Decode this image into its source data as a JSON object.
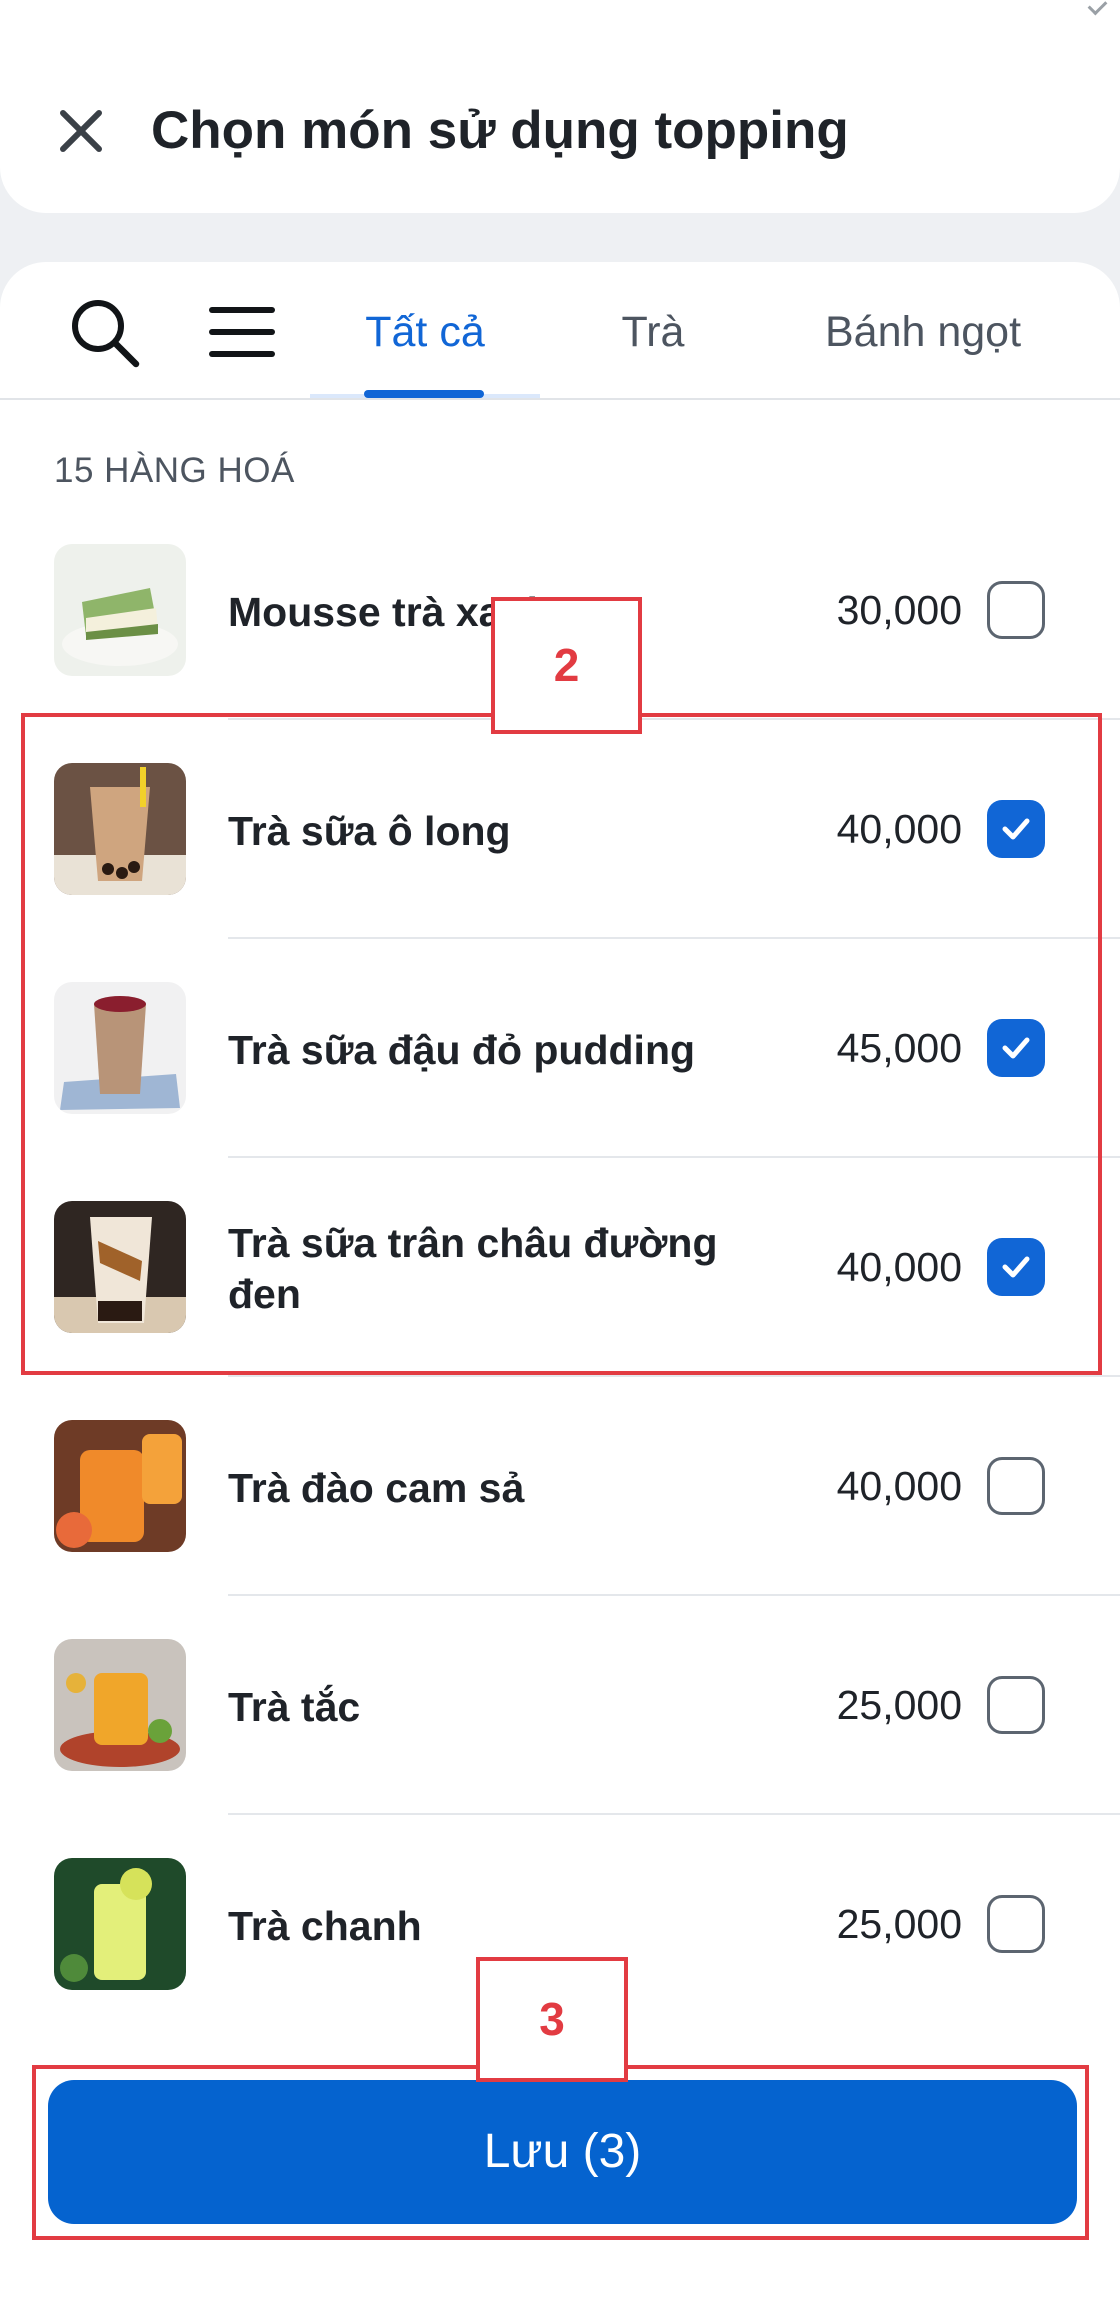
{
  "header": {
    "title": "Chọn món sử dụng topping",
    "close_icon": "close-icon"
  },
  "tabs": {
    "search_icon": "search-icon",
    "menu_icon": "menu-icon",
    "items": [
      {
        "label": "Tất cả",
        "active": true
      },
      {
        "label": "Trà",
        "active": false
      },
      {
        "label": "Bánh ngọt",
        "active": false
      }
    ]
  },
  "list": {
    "count_label": "15 HÀNG HOÁ",
    "items": [
      {
        "name": "Mousse trà xanh",
        "price": "30,000",
        "checked": false
      },
      {
        "name": "Trà sữa ô long",
        "price": "40,000",
        "checked": true
      },
      {
        "name": "Trà sữa đậu đỏ pudding",
        "price": "45,000",
        "checked": true
      },
      {
        "name": "Trà sữa trân châu đường đen",
        "price": "40,000",
        "checked": true
      },
      {
        "name": "Trà đào cam sả",
        "price": "40,000",
        "checked": false
      },
      {
        "name": "Trà tắc",
        "price": "25,000",
        "checked": false
      },
      {
        "name": "Trà chanh",
        "price": "25,000",
        "checked": false
      }
    ]
  },
  "footer": {
    "save_label": "Lưu (3)"
  },
  "annotations": {
    "label_2": "2",
    "label_3": "3"
  },
  "colors": {
    "accent": "#1166d6",
    "button": "#0563cf",
    "annotation": "#e23b42"
  }
}
